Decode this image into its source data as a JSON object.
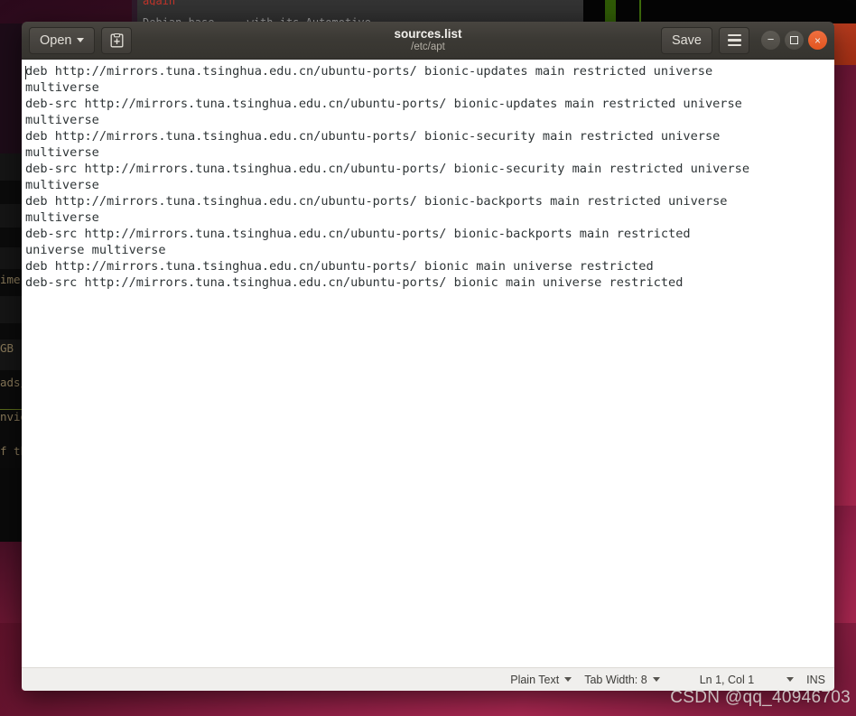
{
  "window": {
    "title": "sources.list",
    "subtitle": "/etc/apt",
    "toolbar": {
      "open_label": "Open",
      "open_caret": "chevron-down-icon",
      "new_document_icon": "new-document-icon",
      "save_label": "Save",
      "menu_icon": "hamburger-menu-icon"
    },
    "controls": {
      "minimize": "−",
      "maximize": "□",
      "close": "×",
      "close_color": "#e2551f"
    }
  },
  "document": {
    "lines": [
      "deb http://mirrors.tuna.tsinghua.edu.cn/ubuntu-ports/ bionic-updates main restricted universe",
      "multiverse",
      "deb-src http://mirrors.tuna.tsinghua.edu.cn/ubuntu-ports/ bionic-updates main restricted universe",
      "multiverse",
      "deb http://mirrors.tuna.tsinghua.edu.cn/ubuntu-ports/ bionic-security main restricted universe",
      "multiverse",
      "deb-src http://mirrors.tuna.tsinghua.edu.cn/ubuntu-ports/ bionic-security main restricted universe",
      "multiverse",
      "deb http://mirrors.tuna.tsinghua.edu.cn/ubuntu-ports/ bionic-backports main restricted universe",
      "multiverse",
      "deb-src http://mirrors.tuna.tsinghua.edu.cn/ubuntu-ports/ bionic-backports main restricted",
      "universe multiverse",
      "deb http://mirrors.tuna.tsinghua.edu.cn/ubuntu-ports/ bionic main universe restricted",
      "deb-src http://mirrors.tuna.tsinghua.edu.cn/ubuntu-ports/ bionic main universe restricted"
    ]
  },
  "statusbar": {
    "language": "Plain Text",
    "tab_width": "Tab Width: 8",
    "position": "Ln 1, Col 1",
    "insert_mode": "INS"
  },
  "background": {
    "terminal_top_red": "again",
    "terminal_top_grey": "Debian-base-....with-its-Automotive",
    "left_terminal_fragments": [
      "GB (t",
      "ads/",
      "nvid",
      "f the"
    ],
    "left_terminal_time_fragment": "ime"
  },
  "watermark": "CSDN @qq_40946703"
}
